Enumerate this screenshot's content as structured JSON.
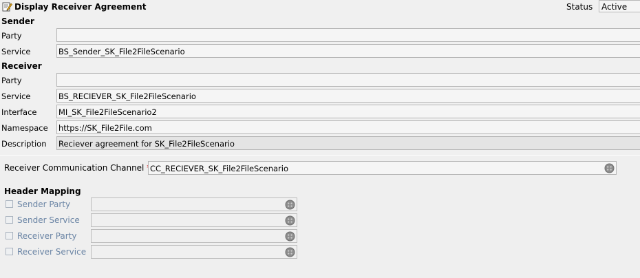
{
  "title": "Display Receiver Agreement",
  "status": {
    "label": "Status",
    "value": "Active"
  },
  "sender": {
    "heading": "Sender",
    "party_label": "Party",
    "party_value": "",
    "service_label": "Service",
    "service_value": "BS_Sender_SK_File2FileScenario"
  },
  "receiver": {
    "heading": "Receiver",
    "party_label": "Party",
    "party_value": "",
    "service_label": "Service",
    "service_value": "BS_RECIEVER_SK_File2FileScenario",
    "interface_label": "Interface",
    "interface_value": "MI_SK_File2FileScenario2",
    "namespace_label": "Namespace",
    "namespace_value": "https://SK_File2File.com",
    "description_label": "Description",
    "description_value": "Reciever agreement for SK_File2FileScenario"
  },
  "channel": {
    "label": "Receiver Communication Channel",
    "required_mark": "*",
    "value": "CC_RECIEVER_SK_File2FileScenario"
  },
  "header_mapping": {
    "heading": "Header Mapping",
    "items": [
      {
        "label": "Sender Party",
        "value": ""
      },
      {
        "label": "Sender Service",
        "value": ""
      },
      {
        "label": "Receiver Party",
        "value": ""
      },
      {
        "label": "Receiver Service",
        "value": ""
      }
    ]
  },
  "icons": {
    "title": "edit-document-icon",
    "value_help": "value-help-icon"
  },
  "colors": {
    "background": "#f0f0f0",
    "field": "#f5f5f5",
    "field_readonly": "#e4e4e4",
    "required": "#cc0000",
    "disabled_label": "#6b85a5"
  }
}
